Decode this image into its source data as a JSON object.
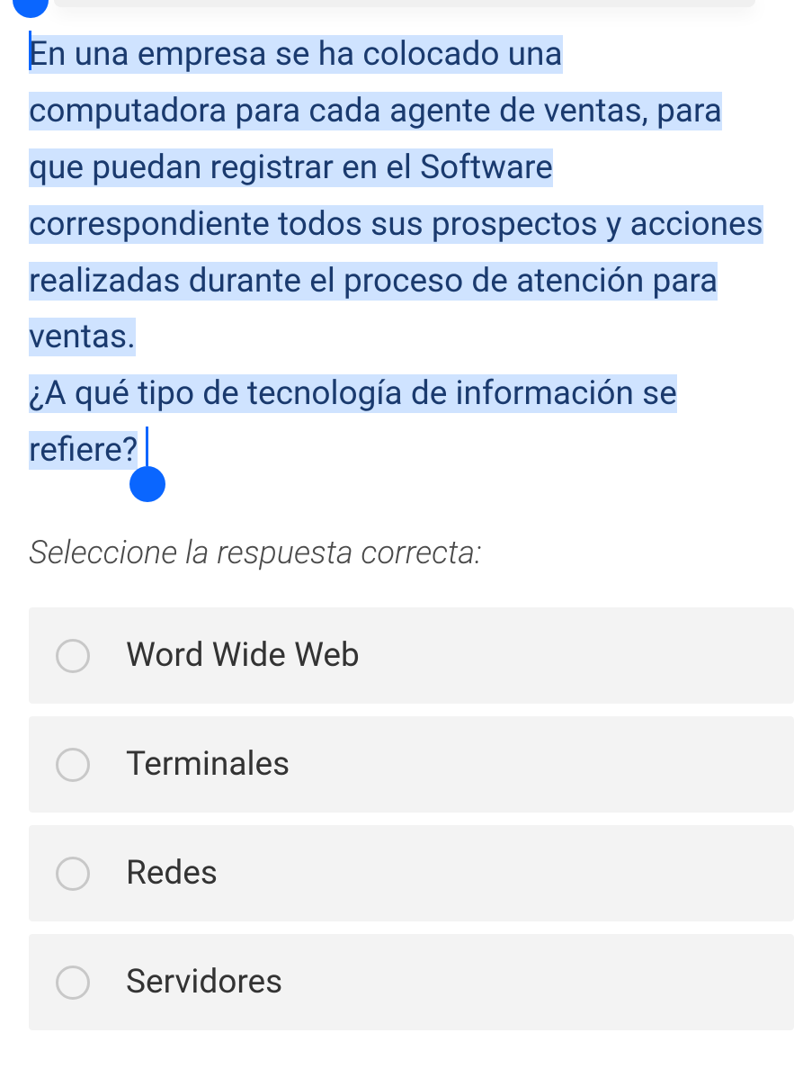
{
  "question": {
    "text_line1": "En una empresa se ha colocado una computadora para cada agente de ventas, para que puedan registrar en el Software correspondiente todos sus prospectos y acciones realizadas durante el proceso de atención para ventas.",
    "text_line2": "¿A qué tipo de tecnología de información se refiere?"
  },
  "instruction": "Seleccione la respuesta correcta:",
  "options": [
    {
      "label": "Word Wide Web"
    },
    {
      "label": "Terminales"
    },
    {
      "label": "Redes"
    },
    {
      "label": "Servidores"
    }
  ],
  "colors": {
    "selection_handle": "#0a66ff",
    "highlight_bg": "#cfe3ff",
    "question_text": "#1a3a6e",
    "option_bg": "#f3f3f3"
  }
}
